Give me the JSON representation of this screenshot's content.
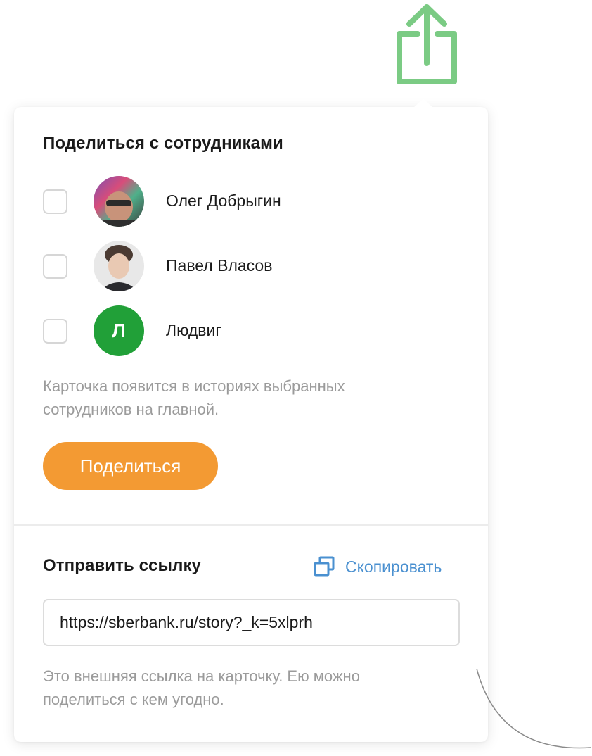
{
  "share_section": {
    "title": "Поделиться с сотрудниками",
    "employees": [
      {
        "name": "Олег Добрыгин",
        "avatar": "photo",
        "checked": false
      },
      {
        "name": "Павел Власов",
        "avatar": "photo",
        "checked": false
      },
      {
        "name": "Людвиг",
        "avatar_letter": "Л",
        "checked": false
      }
    ],
    "hint": "Карточка появится в историях выбранных сотрудников на главной.",
    "button_label": "Поделиться"
  },
  "link_section": {
    "title": "Отправить ссылку",
    "copy_label": "Скопировать",
    "url": "https://sberbank.ru/story?_k=5xlprh",
    "hint": "Это внешняя ссылка на карточку. Ею можно поделиться с кем угодно."
  },
  "icons": {
    "share": "share-icon",
    "copy": "copy-icon"
  },
  "colors": {
    "share_icon": "#7bcb84",
    "button": "#f39a33",
    "avatar_letter_bg": "#21a038",
    "link": "#4a90d0",
    "hint_text": "#9b9b9b"
  }
}
